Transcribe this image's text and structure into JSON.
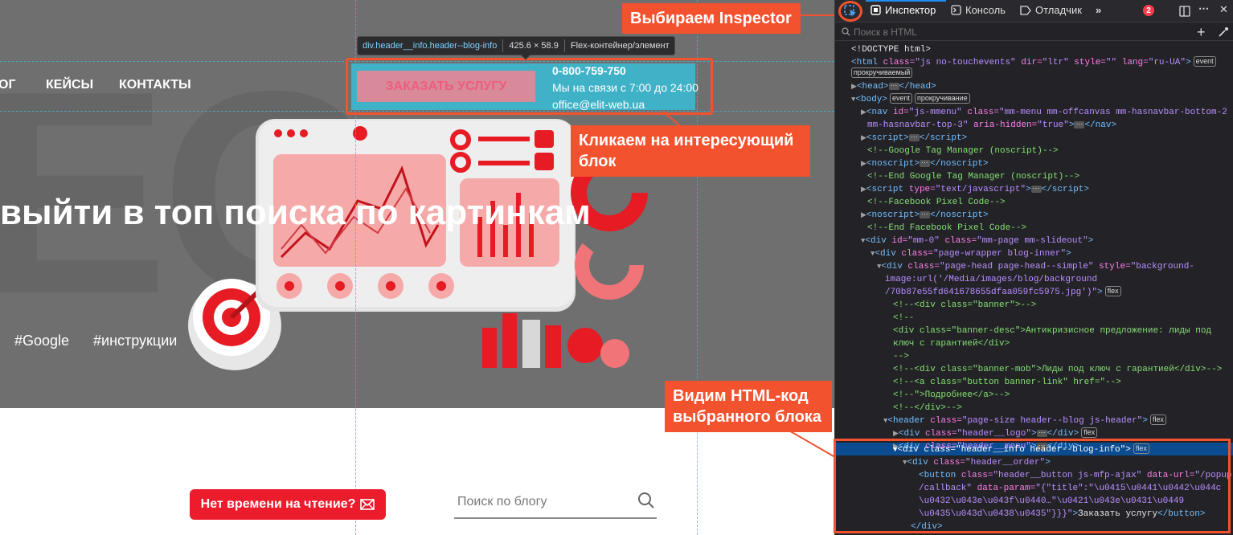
{
  "page": {
    "menu": [
      "ОГ",
      "КЕЙСЫ",
      "КОНТАКТЫ"
    ],
    "big_letters": "EO",
    "headline": "выйти в топ поиска по картинкам",
    "tags": [
      "#Google",
      "#инструкции"
    ],
    "order_button": "ЗАКАЗАТЬ УСЛУГУ",
    "phone": "0-800-759-750",
    "hours": "Мы на связи с 7:00 до 24:00",
    "email": "office@elit-web.ua",
    "noread_button": "Нет времени на чтение?",
    "search_placeholder": "Поиск по блогу",
    "accent_color": "#ec1c2d"
  },
  "tooltip": {
    "selector": "div.header__info.header--blog-info",
    "size": "425.6 × 58.9",
    "kind": "Flex-контейнер/элемент"
  },
  "callouts": {
    "inspector": "Выбираем Inspector",
    "click_block_1": "Кликаем на интересующий",
    "click_block_2": "блок",
    "see_html_1": "Видим HTML-код",
    "see_html_2": "выбранного блока",
    "color": "#f2522e"
  },
  "devtools": {
    "tabs": [
      "Инспектор",
      "Консоль",
      "Отладчик"
    ],
    "error_count": "2",
    "search_placeholder": "Поиск в HTML",
    "icons": [
      "element-picker-icon",
      "inspector-icon",
      "console-icon",
      "debugger-icon",
      "more-tabs-icon",
      "responsive-icon",
      "menu-icon",
      "close-icon",
      "add-node-icon",
      "eyedropper-icon"
    ]
  }
}
